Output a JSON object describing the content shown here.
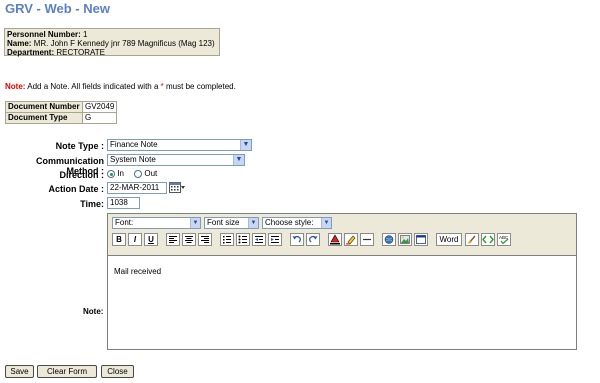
{
  "title": "GRV - Web - New",
  "personnel": {
    "number_label": "Personnel Number:",
    "number_value": "1",
    "name_label": "Name:",
    "name_value": "MR. John F Kennedy jnr 789 Magnificus (Mag 123)",
    "department_label": "Department:",
    "department_value": "RECTORATE"
  },
  "note_line": {
    "prefix": "Note:",
    "text_before_star": "Add a Note. All fields indicated with a",
    "star": "*",
    "text_after_star": "must be completed."
  },
  "document": {
    "number_label": "Document Number",
    "number_value": "GV2049",
    "type_label": "Document Type",
    "type_value": "G"
  },
  "form": {
    "note_type_label": "Note Type :",
    "note_type_value": "Finance Note",
    "comm_method_label": "Communication Method :",
    "comm_method_value": "System Note",
    "direction_label": "Direction :",
    "direction_in": "In",
    "direction_out": "Out",
    "direction_selected": "In",
    "action_date_label": "Action Date :",
    "action_date_value": "22-MAR-2011",
    "time_label": "Time:",
    "time_value": "1038",
    "note_label": "Note:"
  },
  "editor": {
    "font_select": "Font:",
    "size_select": "Font size",
    "style_select": "Choose style:",
    "word_button": "Word",
    "content": "Mail received"
  },
  "buttons": {
    "save": "Save",
    "clear_form": "Clear Form",
    "close": "Close"
  }
}
